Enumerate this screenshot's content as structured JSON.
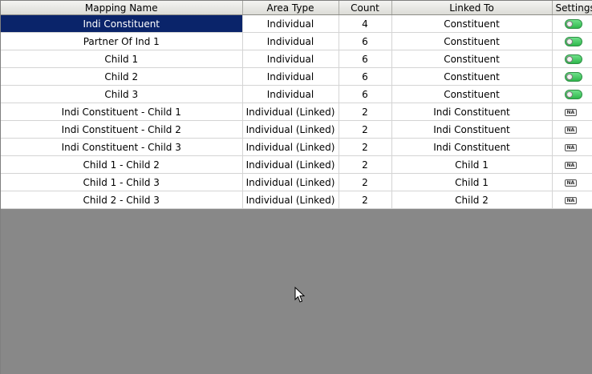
{
  "columns": [
    "Mapping Name",
    "Area Type",
    "Count",
    "Linked To",
    "Settings"
  ],
  "rows": [
    {
      "mapping_name": "Indi Constituent",
      "area_type": "Individual",
      "count": "4",
      "linked_to": "Constituent",
      "settings": "toggle-icon",
      "selected": true
    },
    {
      "mapping_name": "Partner Of Ind 1",
      "area_type": "Individual",
      "count": "6",
      "linked_to": "Constituent",
      "settings": "toggle-icon"
    },
    {
      "mapping_name": "Child 1",
      "area_type": "Individual",
      "count": "6",
      "linked_to": "Constituent",
      "settings": "toggle-icon"
    },
    {
      "mapping_name": "Child 2",
      "area_type": "Individual",
      "count": "6",
      "linked_to": "Constituent",
      "settings": "toggle-icon"
    },
    {
      "mapping_name": "Child 3",
      "area_type": "Individual",
      "count": "6",
      "linked_to": "Constituent",
      "settings": "toggle-icon"
    },
    {
      "mapping_name": "Indi Constituent - Child 1",
      "area_type": "Individual (Linked)",
      "count": "2",
      "linked_to": "Indi Constituent",
      "settings": "NA"
    },
    {
      "mapping_name": "Indi Constituent - Child 2",
      "area_type": "Individual (Linked)",
      "count": "2",
      "linked_to": "Indi Constituent",
      "settings": "NA"
    },
    {
      "mapping_name": "Indi Constituent - Child 3",
      "area_type": "Individual (Linked)",
      "count": "2",
      "linked_to": "Indi Constituent",
      "settings": "NA"
    },
    {
      "mapping_name": "Child 1 - Child 2",
      "area_type": "Individual (Linked)",
      "count": "2",
      "linked_to": "Child 1",
      "settings": "NA"
    },
    {
      "mapping_name": "Child 1 - Child 3",
      "area_type": "Individual (Linked)",
      "count": "2",
      "linked_to": "Child 1",
      "settings": "NA"
    },
    {
      "mapping_name": "Child 2 - Child 3",
      "area_type": "Individual (Linked)",
      "count": "2",
      "linked_to": "Child 2",
      "settings": "NA"
    }
  ],
  "colors": {
    "selection": "#0a246a",
    "empty_area": "#888888",
    "toggle_on": "#2fb84c"
  }
}
